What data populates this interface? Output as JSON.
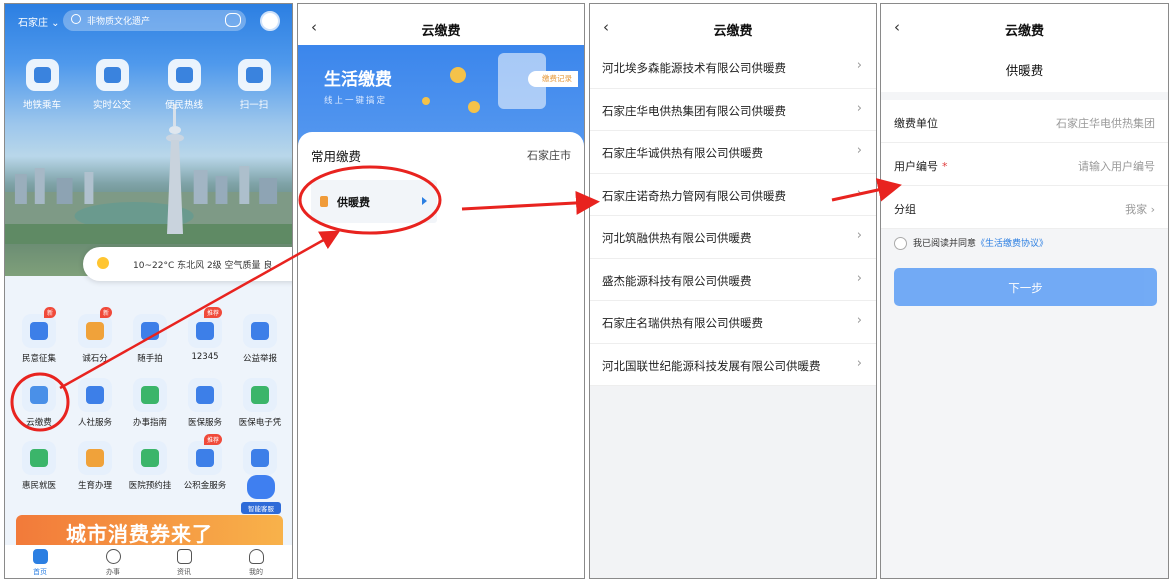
{
  "panel1": {
    "city": "石家庄",
    "search_placeholder": "非物质文化遗产",
    "quick_items": [
      "地铁乘车",
      "实时公交",
      "便民热线",
      "扫一扫"
    ],
    "weather": "10~22°C 东北风 2级 空气质量 良",
    "grid": [
      {
        "label": "民意征集",
        "badge": "新",
        "color": "#3d7fe8"
      },
      {
        "label": "诚石分",
        "badge": "新",
        "color": "#f0a23a"
      },
      {
        "label": "随手拍",
        "badge": "",
        "color": "#3d7fe8"
      },
      {
        "label": "12345",
        "badge": "推荐",
        "color": "#3d7fe8"
      },
      {
        "label": "公益举报",
        "badge": "",
        "color": "#3d7fe8"
      },
      {
        "label": "云缴费",
        "badge": "",
        "color": "#4a90e8"
      },
      {
        "label": "人社服务",
        "badge": "",
        "color": "#3d7fe8"
      },
      {
        "label": "办事指南",
        "badge": "",
        "color": "#3bb56a"
      },
      {
        "label": "医保服务",
        "badge": "",
        "color": "#3d7fe8"
      },
      {
        "label": "医保电子凭",
        "badge": "",
        "color": "#3bb56a"
      },
      {
        "label": "惠民就医",
        "badge": "",
        "color": "#3bb56a"
      },
      {
        "label": "生育办理",
        "badge": "",
        "color": "#f0a23a"
      },
      {
        "label": "医院预约挂",
        "badge": "",
        "color": "#3bb56a"
      },
      {
        "label": "公积金服务",
        "badge": "推荐",
        "color": "#3d7fe8"
      },
      {
        "label": "",
        "badge": "",
        "color": "#3d7fe8"
      }
    ],
    "banner_text": "城市消费券来了",
    "ai_label": "智能客服",
    "tabs": [
      "首页",
      "办事",
      "资讯",
      "我的"
    ]
  },
  "panel2": {
    "title": "云缴费",
    "banner_title": "生活缴费",
    "banner_sub": "线上一键搞定",
    "record": "缴费记录",
    "section_title": "常用缴费",
    "city": "石家庄市",
    "heat_label": "供暖费"
  },
  "panel3": {
    "title": "云缴费",
    "companies": [
      "河北埃多森能源技术有限公司供暖费",
      "石家庄华电供热集团有限公司供暖费",
      "石家庄华诚供热有限公司供暖费",
      "石家庄诺奇热力管网有限公司供暖费",
      "河北筑融供热有限公司供暖费",
      "盛杰能源科技有限公司供暖费",
      "石家庄名瑞供热有限公司供暖费",
      "河北国联世纪能源科技发展有限公司供暖费"
    ]
  },
  "panel4": {
    "title": "云缴费",
    "subtitle": "供暖费",
    "unit_label": "缴费单位",
    "unit_value": "石家庄华电供热集团",
    "user_label": "用户编号",
    "user_placeholder": "请输入用户编号",
    "group_label": "分组",
    "group_value": "我家",
    "agree_text": "我已阅读并同意",
    "agree_link": "《生活缴费协议》",
    "next": "下一步"
  },
  "colors": {
    "accent": "#2c7fe2",
    "annotation": "#e8231f"
  }
}
